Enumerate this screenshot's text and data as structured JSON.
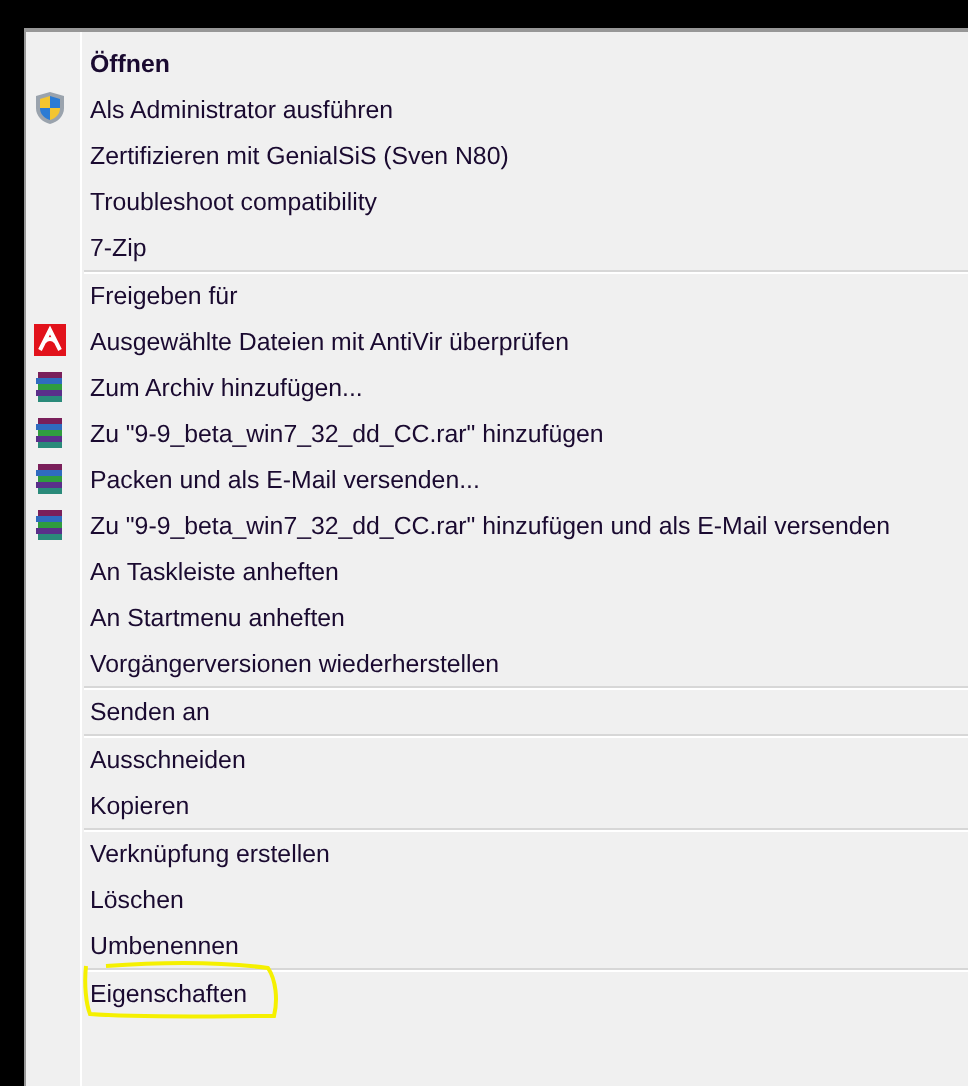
{
  "menu": {
    "groups": [
      {
        "items": [
          {
            "label": "Öffnen",
            "default": true
          },
          {
            "label": "Als Administrator ausführen",
            "kind": "shield"
          },
          {
            "label": "Zertifizieren mit GenialSiS (Sven N80)"
          },
          {
            "label": "Troubleshoot compatibility"
          },
          {
            "label": "7-Zip"
          }
        ]
      },
      {
        "items": [
          {
            "label": "Freigeben für"
          },
          {
            "label": "Ausgewählte Dateien mit AntiVir überprüfen",
            "kind": "antivir"
          },
          {
            "label": "Zum Archiv hinzufügen...",
            "kind": "books"
          },
          {
            "label": "Zu \"9-9_beta_win7_32_dd_CC.rar\" hinzufügen",
            "kind": "books"
          },
          {
            "label": "Packen und als E-Mail versenden...",
            "kind": "books"
          },
          {
            "label": "Zu \"9-9_beta_win7_32_dd_CC.rar\" hinzufügen und als E-Mail versenden",
            "kind": "books"
          },
          {
            "label": "An Taskleiste anheften"
          },
          {
            "label": "An Startmenu anheften"
          },
          {
            "label": "Vorgängerversionen wiederherstellen"
          }
        ]
      },
      {
        "items": [
          {
            "label": "Senden an"
          }
        ]
      },
      {
        "items": [
          {
            "label": "Ausschneiden"
          },
          {
            "label": "Kopieren"
          }
        ]
      },
      {
        "items": [
          {
            "label": "Verknüpfung erstellen"
          },
          {
            "label": "Löschen"
          },
          {
            "label": "Umbenennen"
          }
        ]
      },
      {
        "items": [
          {
            "label": "Eigenschaften",
            "circled": true
          }
        ]
      }
    ]
  }
}
